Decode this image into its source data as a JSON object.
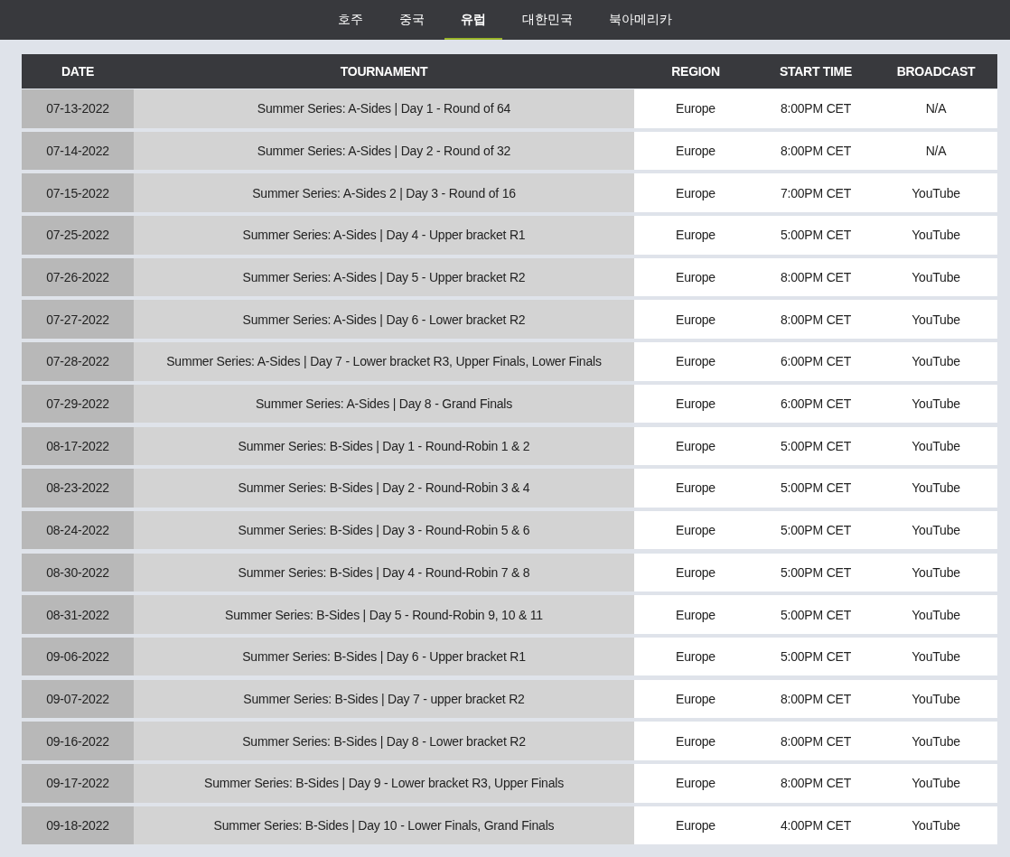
{
  "nav": {
    "tabs": [
      {
        "label": "호주",
        "selected": false
      },
      {
        "label": "중국",
        "selected": false
      },
      {
        "label": "유럽",
        "selected": true
      },
      {
        "label": "대한민국",
        "selected": false
      },
      {
        "label": "북아메리카",
        "selected": false
      }
    ]
  },
  "table": {
    "columns": [
      "DATE",
      "TOURNAMENT",
      "REGION",
      "START TIME",
      "BROADCAST"
    ],
    "rows": [
      [
        "07-13-2022",
        "Summer Series: A-Sides | Day 1 - Round of 64",
        "Europe",
        "8:00PM CET",
        "N/A"
      ],
      [
        "07-14-2022",
        "Summer Series: A-Sides | Day 2 - Round of 32",
        "Europe",
        "8:00PM CET",
        "N/A"
      ],
      [
        "07-15-2022",
        "Summer Series: A-Sides 2 | Day 3 - Round of 16",
        "Europe",
        "7:00PM CET",
        "YouTube"
      ],
      [
        "07-25-2022",
        "Summer Series: A-Sides | Day 4 - Upper bracket R1",
        "Europe",
        "5:00PM CET",
        "YouTube"
      ],
      [
        "07-26-2022",
        "Summer Series: A-Sides | Day 5 - Upper bracket R2",
        "Europe",
        "8:00PM CET",
        "YouTube"
      ],
      [
        "07-27-2022",
        "Summer Series: A-Sides | Day 6 - Lower bracket R2",
        "Europe",
        "8:00PM CET",
        "YouTube"
      ],
      [
        "07-28-2022",
        "Summer Series: A-Sides | Day 7 - Lower bracket R3, Upper Finals, Lower Finals",
        "Europe",
        "6:00PM CET",
        "YouTube"
      ],
      [
        "07-29-2022",
        "Summer Series: A-Sides | Day 8 - Grand Finals",
        "Europe",
        "6:00PM CET",
        "YouTube"
      ],
      [
        "08-17-2022",
        "Summer Series: B-Sides | Day 1 - Round-Robin 1 & 2",
        "Europe",
        "5:00PM CET",
        "YouTube"
      ],
      [
        "08-23-2022",
        "Summer Series: B-Sides | Day 2 - Round-Robin 3 & 4",
        "Europe",
        "5:00PM CET",
        "YouTube"
      ],
      [
        "08-24-2022",
        "Summer Series: B-Sides | Day 3 - Round-Robin 5 & 6",
        "Europe",
        "5:00PM CET",
        "YouTube"
      ],
      [
        "08-30-2022",
        "Summer Series: B-Sides | Day 4 - Round-Robin 7 & 8",
        "Europe",
        "5:00PM CET",
        "YouTube"
      ],
      [
        "08-31-2022",
        "Summer Series: B-Sides | Day 5 - Round-Robin 9, 10 & 11",
        "Europe",
        "5:00PM CET",
        "YouTube"
      ],
      [
        "09-06-2022",
        "Summer Series: B-Sides | Day 6 - Upper bracket R1",
        "Europe",
        "5:00PM CET",
        "YouTube"
      ],
      [
        "09-07-2022",
        "Summer Series: B-Sides | Day 7 - upper bracket R2",
        "Europe",
        "8:00PM CET",
        "YouTube"
      ],
      [
        "09-16-2022",
        "Summer Series: B-Sides | Day 8 - Lower bracket R2",
        "Europe",
        "8:00PM CET",
        "YouTube"
      ],
      [
        "09-17-2022",
        "Summer Series: B-Sides | Day 9 - Lower bracket R3, Upper Finals",
        "Europe",
        "8:00PM CET",
        "YouTube"
      ],
      [
        "09-18-2022",
        "Summer Series: B-Sides | Day 10 - Lower Finals, Grand Finals",
        "Europe",
        "4:00PM CET",
        "YouTube"
      ]
    ]
  }
}
